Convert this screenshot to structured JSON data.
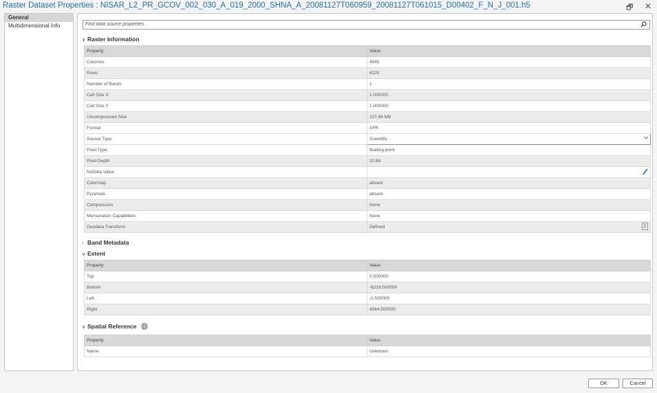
{
  "window": {
    "title": "Raster Dataset Properties : NISAR_L2_PR_GCOV_002_030_A_019_2000_SHNA_A_20081127T060959_20081127T061015_D00402_F_N_J_001.h5",
    "restore_glyph": "🗗",
    "close_glyph": "✕"
  },
  "nav": {
    "items": [
      "General",
      "Multidimensional Info"
    ],
    "selected": "General"
  },
  "search": {
    "placeholder": "Find data source properties"
  },
  "sections": {
    "raster_info": "Raster Information",
    "band_metadata": "Band Metadata",
    "extent": "Extent",
    "spatial_reference": "Spatial Reference"
  },
  "table_headers": {
    "property": "Property",
    "value": "Value"
  },
  "raster_info_rows": [
    {
      "property": "Columns",
      "value": "4545"
    },
    {
      "property": "Rows",
      "value": "6220"
    },
    {
      "property": "Number of Bands",
      "value": "1"
    },
    {
      "property": "Cell Size X",
      "value": "1.000000"
    },
    {
      "property": "Cell Size Y",
      "value": "1.000000"
    },
    {
      "property": "Uncompressed Size",
      "value": "107.84 MB"
    },
    {
      "property": "Format",
      "value": "AFR"
    },
    {
      "property": "Source Type",
      "value": "Scientific"
    },
    {
      "property": "Pixel Type",
      "value": "floating point"
    },
    {
      "property": "Pixel Depth",
      "value": "32 Bit"
    },
    {
      "property": "NoData Value",
      "value": ""
    },
    {
      "property": "Colormap",
      "value": "absent"
    },
    {
      "property": "Pyramids",
      "value": "absent"
    },
    {
      "property": "Compression",
      "value": "None"
    },
    {
      "property": "Mensuration Capabilities",
      "value": "None"
    },
    {
      "property": "Geodata Transform",
      "value": "Defined"
    }
  ],
  "extent_rows": [
    {
      "property": "Top",
      "value": "0.500000"
    },
    {
      "property": "Bottom",
      "value": "-6219.500000"
    },
    {
      "property": "Left",
      "value": "-0.500000"
    },
    {
      "property": "Right",
      "value": "4544.500000"
    }
  ],
  "spatial_ref_rows": [
    {
      "property": "Name",
      "value": "Unknown"
    }
  ],
  "buttons": {
    "ok": "OK",
    "cancel": "Cancel"
  },
  "icons": {
    "search": "magnifier-icon",
    "dropdown": "chevron-down-icon",
    "edit": "pencil-icon",
    "table": "table-icon",
    "globe": "globe-icon"
  },
  "colors": {
    "title": "#1f6fad",
    "header_row": "#d8d8d8",
    "alt_row": "#ececec",
    "pencil": "#1f6fad"
  }
}
